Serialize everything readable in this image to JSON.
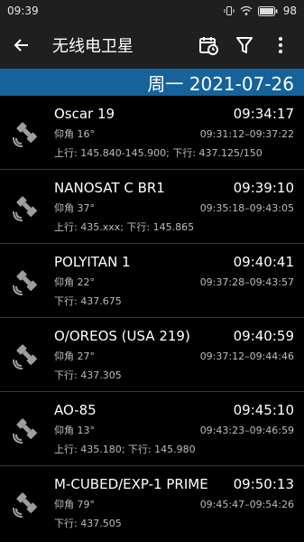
{
  "status": {
    "time": "09:39",
    "battery": "98"
  },
  "appbar": {
    "title": "无线电卫星"
  },
  "date_banner": "周一 2021-07-26",
  "passes": [
    {
      "name": "Oscar 19",
      "time": "09:34:17",
      "elevation": "仰角 16°",
      "window": "09:31:12–09:37:22",
      "freq": "上行: 145.840-145.900; 下行: 437.125/150"
    },
    {
      "name": "NANOSAT C BR1",
      "time": "09:39:10",
      "elevation": "仰角 37°",
      "window": "09:35:18–09:43:05",
      "freq": "上行: 435.xxx; 下行: 145.865"
    },
    {
      "name": "POLYITAN 1",
      "time": "09:40:41",
      "elevation": "仰角 22°",
      "window": "09:37:28–09:43:57",
      "freq": "下行: 437.675"
    },
    {
      "name": "O/OREOS (USA 219)",
      "time": "09:40:59",
      "elevation": "仰角 27°",
      "window": "09:37:12–09:44:46",
      "freq": "下行: 437.305"
    },
    {
      "name": "AO-85",
      "time": "09:45:10",
      "elevation": "仰角 13°",
      "window": "09:43:23–09:46:59",
      "freq": "上行: 435.180; 下行: 145.980"
    },
    {
      "name": "M-CUBED/EXP-1 PRIME",
      "time": "09:50:13",
      "elevation": "仰角 79°",
      "window": "09:45:47–09:54:26",
      "freq": "下行: 437.505"
    }
  ]
}
